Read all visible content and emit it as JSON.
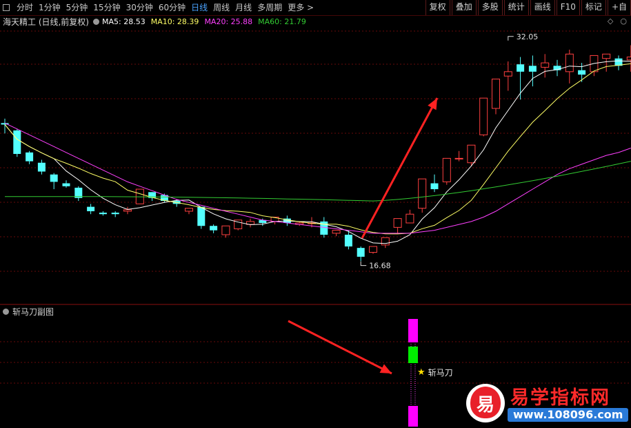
{
  "toolbar": {
    "periods": [
      "分时",
      "1分钟",
      "5分钟",
      "15分钟",
      "30分钟",
      "60分钟",
      "日线",
      "周线",
      "月线",
      "多周期",
      "更多 >"
    ],
    "active_period": "日线",
    "actions": [
      "复权",
      "叠加",
      "多股",
      "统计",
      "画线",
      "F10",
      "标记",
      "+自"
    ]
  },
  "legend": {
    "stock": "海天精工 (日线,前复权)",
    "ma5": "MA5: 28.53",
    "ma10": "MA10: 28.39",
    "ma20": "MA20: 25.88",
    "ma60": "MA60: 21.79"
  },
  "colors": {
    "up": "#ff4040",
    "down": "#54ffff",
    "ma5": "#ffffff",
    "ma10": "#ffff66",
    "ma20": "#ff40ff",
    "ma60": "#33cc33",
    "grid": "#6a0a0a",
    "signal_magenta": "#ff00ff",
    "signal_green": "#00ee00",
    "arrow": "#ff2222"
  },
  "annotations": {
    "high_label": "32.05",
    "low_label": "16.68"
  },
  "subchart": {
    "title": "斩马刀副图",
    "signal_label": "斩马刀"
  },
  "watermark": {
    "logo_char": "易",
    "title": "易学指标网",
    "url": "www.108096.com"
  },
  "chart_data": {
    "type": "candlestick",
    "candles": [
      [
        28.3,
        28.6,
        28.2,
        27.6
      ],
      [
        27.8,
        27.9,
        26.2,
        26.0
      ],
      [
        26.3,
        26.4,
        25.7,
        25.5
      ],
      [
        25.6,
        25.8,
        25.0,
        24.8
      ],
      [
        24.8,
        24.9,
        24.3,
        23.8
      ],
      [
        24.2,
        24.4,
        24.0,
        23.9
      ],
      [
        23.9,
        24.0,
        23.2,
        23.0
      ],
      [
        22.6,
        22.8,
        22.3,
        22.1
      ],
      [
        22.2,
        22.3,
        22.1,
        22.0
      ],
      [
        22.2,
        22.3,
        22.1,
        21.9
      ],
      [
        22.3,
        22.6,
        22.4,
        22.1
      ],
      [
        22.8,
        23.4,
        23.8,
        22.8
      ],
      [
        23.6,
        23.6,
        23.2,
        23.0
      ],
      [
        23.4,
        23.5,
        23.0,
        22.9
      ],
      [
        23.0,
        23.1,
        22.8,
        22.6
      ],
      [
        22.3,
        22.4,
        22.5,
        22.1
      ],
      [
        22.6,
        22.6,
        21.3,
        21.1
      ],
      [
        21.3,
        21.4,
        21.0,
        20.8
      ],
      [
        20.7,
        20.7,
        21.3,
        20.5
      ],
      [
        21.1,
        21.5,
        21.7,
        21.0
      ],
      [
        21.4,
        21.8,
        21.6,
        21.2
      ],
      [
        21.7,
        21.8,
        21.5,
        21.3
      ],
      [
        21.6,
        21.8,
        21.9,
        21.4
      ],
      [
        21.8,
        22.0,
        21.5,
        21.3
      ],
      [
        21.4,
        21.6,
        21.5,
        21.3
      ],
      [
        21.5,
        21.9,
        21.5,
        21.2
      ],
      [
        21.6,
        21.9,
        20.7,
        20.5
      ],
      [
        20.8,
        21.0,
        21.0,
        20.6
      ],
      [
        20.7,
        21.0,
        19.9,
        19.7
      ],
      [
        19.8,
        19.9,
        19.2,
        18.9
      ],
      [
        19.5,
        19.6,
        19.9,
        19.4
      ],
      [
        20.0,
        20.2,
        20.5,
        19.8
      ],
      [
        21.2,
        21.4,
        21.8,
        20.8
      ],
      [
        21.5,
        22.4,
        22.1,
        21.5
      ],
      [
        22.5,
        22.8,
        24.5,
        22.2
      ],
      [
        24.2,
        24.8,
        23.8,
        23.6
      ],
      [
        24.3,
        24.6,
        25.9,
        24.1
      ],
      [
        25.9,
        26.4,
        25.9,
        25.7
      ],
      [
        25.6,
        26.6,
        26.8,
        25.4
      ],
      [
        27.5,
        27.8,
        30.0,
        27.4
      ],
      [
        29.3,
        30.4,
        31.3,
        28.9
      ],
      [
        31.5,
        32.5,
        31.8,
        30.5
      ],
      [
        32.3,
        32.8,
        31.8,
        29.9
      ],
      [
        32.2,
        32.9,
        31.8,
        30.8
      ],
      [
        32.1,
        33.0,
        32.4,
        31.4
      ],
      [
        32.2,
        32.6,
        31.9,
        31.5
      ],
      [
        31.8,
        33.3,
        33.0,
        31.0
      ],
      [
        31.9,
        32.4,
        31.6,
        31.1
      ],
      [
        31.8,
        32.7,
        32.9,
        31.5
      ],
      [
        32.7,
        33.0,
        33.0,
        31.8
      ],
      [
        32.7,
        32.9,
        32.2,
        31.9
      ],
      [
        32.6,
        33.6,
        32.8,
        31.8
      ]
    ],
    "ma5_last": 28.53,
    "ma10_last": 28.39,
    "ma20_last": 25.88,
    "ma60_last": 21.79,
    "high": 32.05,
    "low": 16.68
  }
}
